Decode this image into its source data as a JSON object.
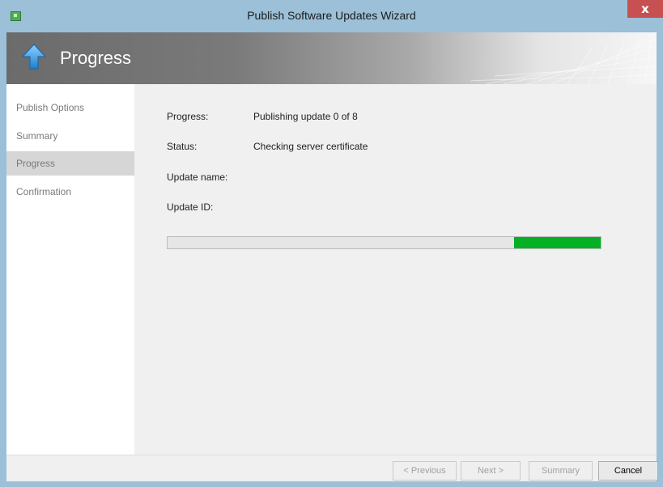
{
  "window": {
    "title": "Publish Software Updates Wizard",
    "close_label": "x"
  },
  "banner": {
    "title": "Progress",
    "icon": "up-arrow-icon"
  },
  "sidebar": {
    "items": [
      {
        "label": "Publish Options",
        "active": false
      },
      {
        "label": "Summary",
        "active": false
      },
      {
        "label": "Progress",
        "active": true
      },
      {
        "label": "Confirmation",
        "active": false
      }
    ]
  },
  "main": {
    "fields": [
      {
        "label": "Progress:",
        "value": "Publishing update 0 of 8"
      },
      {
        "label": "Status:",
        "value": "Checking server certificate"
      },
      {
        "label": "Update name:",
        "value": ""
      },
      {
        "label": "Update ID:",
        "value": ""
      }
    ],
    "progress": {
      "style": "marquee",
      "segment_start_fraction": 0.8,
      "segment_width_fraction": 0.2
    }
  },
  "footer": {
    "buttons": [
      {
        "label": "< Previous",
        "enabled": false
      },
      {
        "label": "Next >",
        "enabled": false
      },
      {
        "label": "Summary",
        "enabled": false
      },
      {
        "label": "Cancel",
        "enabled": true
      }
    ]
  },
  "colors": {
    "titlebar": "#9bc0d7",
    "close_button": "#c75050",
    "progress_fill": "#06b025",
    "active_nav": "#d6d6d6"
  }
}
